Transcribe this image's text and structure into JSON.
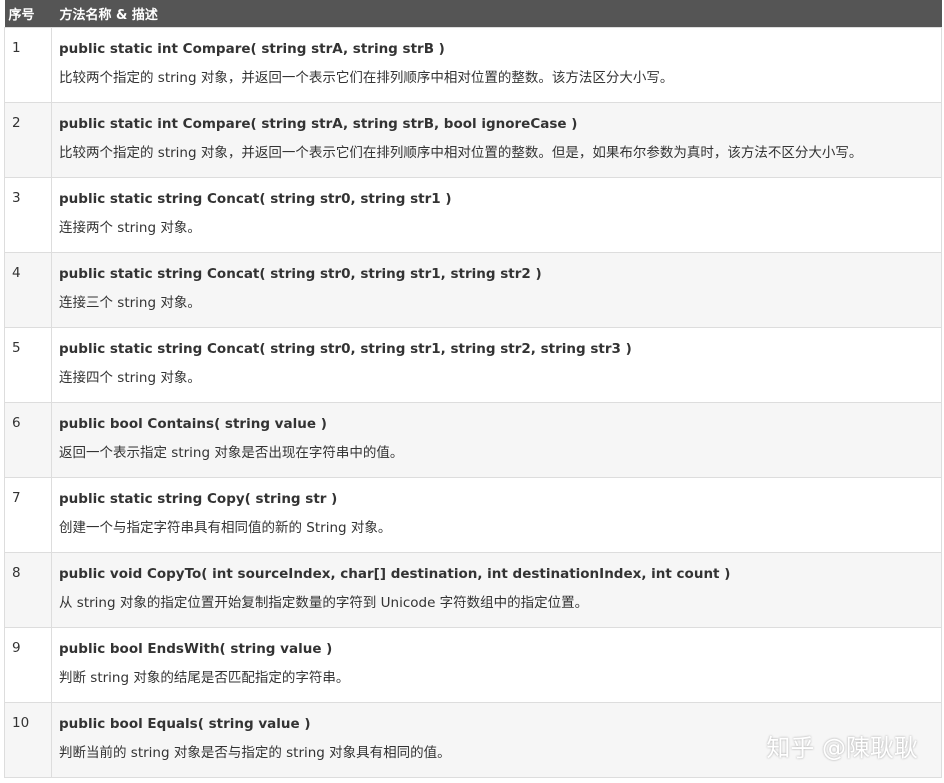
{
  "header": {
    "num_label": "序号",
    "desc_label": "方法名称 & 描述"
  },
  "rows": [
    {
      "num": "1",
      "signature": "public static int Compare( string strA, string strB )",
      "description": "比较两个指定的 string 对象，并返回一个表示它们在排列顺序中相对位置的整数。该方法区分大小写。"
    },
    {
      "num": "2",
      "signature": "public static int Compare( string strA, string strB, bool ignoreCase )",
      "description": "比较两个指定的 string 对象，并返回一个表示它们在排列顺序中相对位置的整数。但是，如果布尔参数为真时，该方法不区分大小写。"
    },
    {
      "num": "3",
      "signature": "public static string Concat( string str0, string str1 )",
      "description": "连接两个 string 对象。"
    },
    {
      "num": "4",
      "signature": "public static string Concat( string str0, string str1, string str2 )",
      "description": "连接三个 string 对象。"
    },
    {
      "num": "5",
      "signature": "public static string Concat( string str0, string str1, string str2, string str3 )",
      "description": "连接四个 string 对象。"
    },
    {
      "num": "6",
      "signature": "public bool Contains( string value )",
      "description": "返回一个表示指定 string 对象是否出现在字符串中的值。"
    },
    {
      "num": "7",
      "signature": "public static string Copy( string str )",
      "description": "创建一个与指定字符串具有相同值的新的 String 对象。"
    },
    {
      "num": "8",
      "signature": "public void CopyTo( int sourceIndex, char[] destination, int destinationIndex, int count )",
      "description": "从 string 对象的指定位置开始复制指定数量的字符到 Unicode 字符数组中的指定位置。"
    },
    {
      "num": "9",
      "signature": "public bool EndsWith( string value )",
      "description": "判断 string 对象的结尾是否匹配指定的字符串。"
    },
    {
      "num": "10",
      "signature": "public bool Equals( string value )",
      "description": "判断当前的 string 对象是否与指定的 string 对象具有相同的值。"
    }
  ],
  "watermark": "知乎 @陳耿耿"
}
